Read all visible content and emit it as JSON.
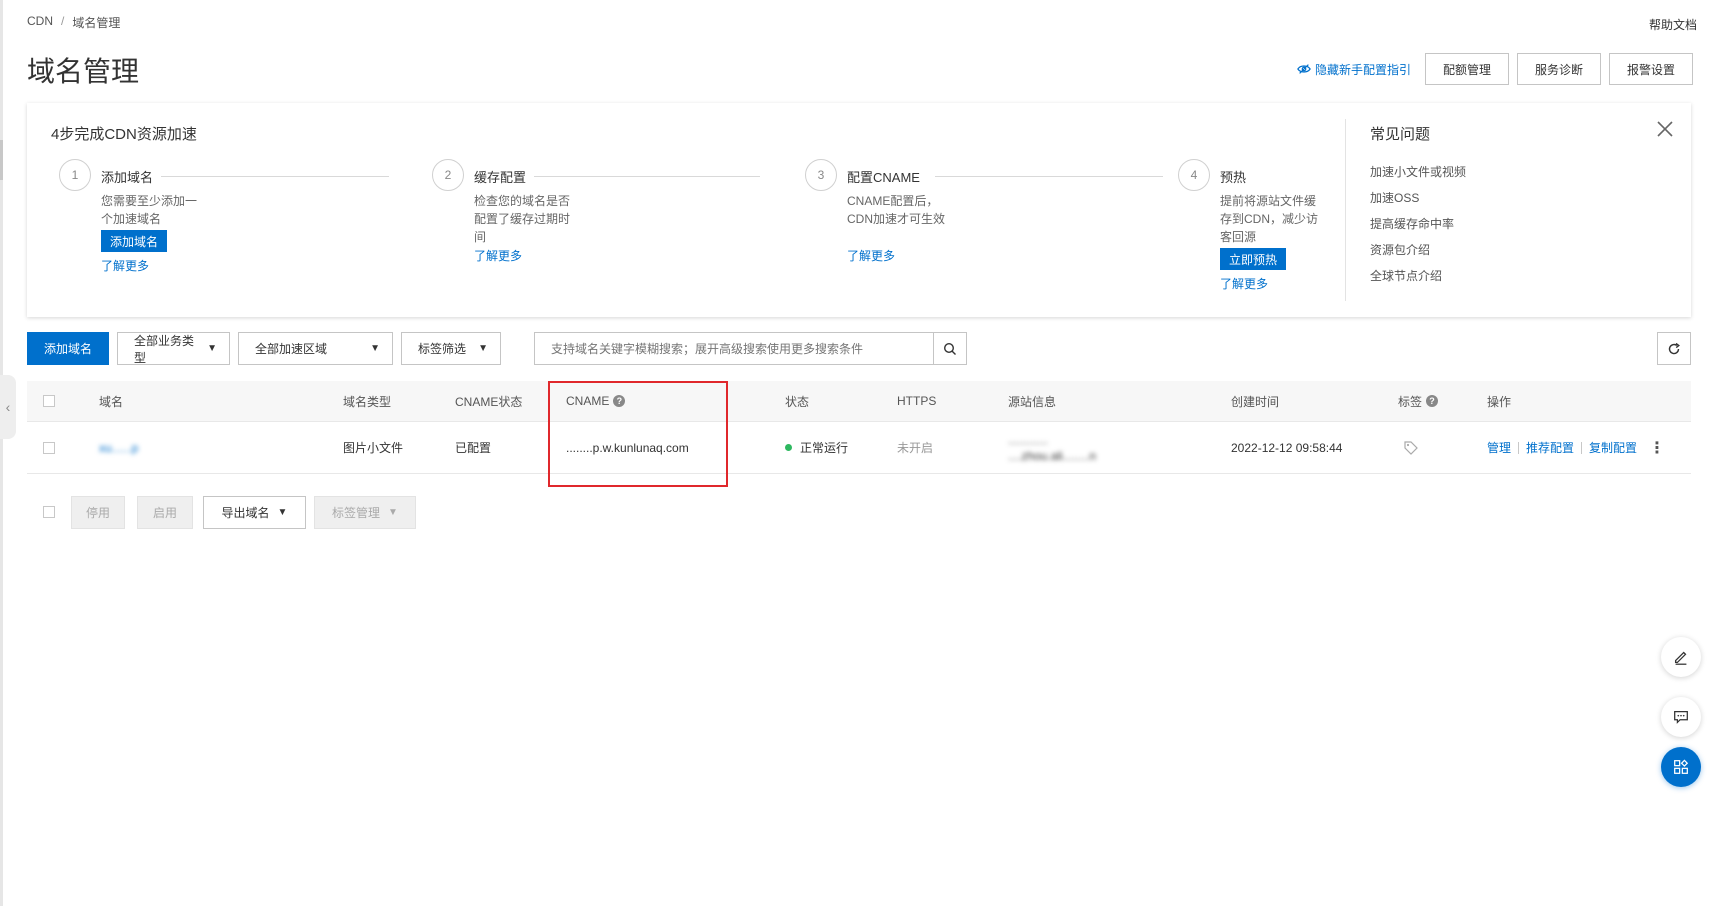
{
  "breadcrumb": {
    "root": "CDN",
    "separator": "/",
    "current": "域名管理"
  },
  "help_doc": "帮助文档",
  "page_title": "域名管理",
  "header_actions": {
    "hide_guide": "隐藏新手配置指引",
    "quota": "配额管理",
    "diagnose": "服务诊断",
    "alerts": "报警设置"
  },
  "guide": {
    "title": "4步完成CDN资源加速",
    "steps": [
      {
        "num": "1",
        "name": "添加域名",
        "desc": "您需要至少添加一个加速域名",
        "button": "添加域名",
        "link": "了解更多"
      },
      {
        "num": "2",
        "name": "缓存配置",
        "desc": "检查您的域名是否配置了缓存过期时间",
        "link": "了解更多"
      },
      {
        "num": "3",
        "name": "配置CNAME",
        "desc": "CNAME配置后，CDN加速才可生效",
        "link": "了解更多"
      },
      {
        "num": "4",
        "name": "预热",
        "desc": "提前将源站文件缓存到CDN，减少访客回源",
        "button": "立即预热",
        "link": "了解更多"
      }
    ],
    "faq_title": "常见问题",
    "faq": [
      "加速小文件或视频",
      "加速OSS",
      "提高缓存命中率",
      "资源包介绍",
      "全球节点介绍"
    ]
  },
  "toolbar": {
    "add_domain": "添加域名",
    "business_type": "全部业务类型",
    "region": "全部加速区域",
    "tag_filter": "标签筛选",
    "search_placeholder": "支持域名关键字模糊搜索；展开高级搜索使用更多搜索条件"
  },
  "table": {
    "headers": {
      "domain": "域名",
      "type": "域名类型",
      "cname_status": "CNAME状态",
      "cname": "CNAME",
      "status": "状态",
      "https": "HTTPS",
      "origin": "源站信息",
      "created": "创建时间",
      "tags": "标签",
      "ops": "操作"
    },
    "rows": [
      {
        "domain": "xu......p",
        "type": "图片小文件",
        "cname_status": "已配置",
        "cname": "........p.w.kunlunaq.com",
        "status": "正常运行",
        "https": "未开启",
        "origin_line1": "............",
        "origin_line2": "....zhou.ali........n",
        "created": "2022-12-12 09:58:44",
        "ops": {
          "manage": "管理",
          "recommend": "推荐配置",
          "copy": "复制配置"
        }
      }
    ]
  },
  "bulk": {
    "disable": "停用",
    "enable": "启用",
    "export": "导出域名",
    "tag": "标签管理"
  },
  "colors": {
    "primary": "#0070cc",
    "highlight": "#e0282c",
    "status_ok": "#2eb860"
  }
}
